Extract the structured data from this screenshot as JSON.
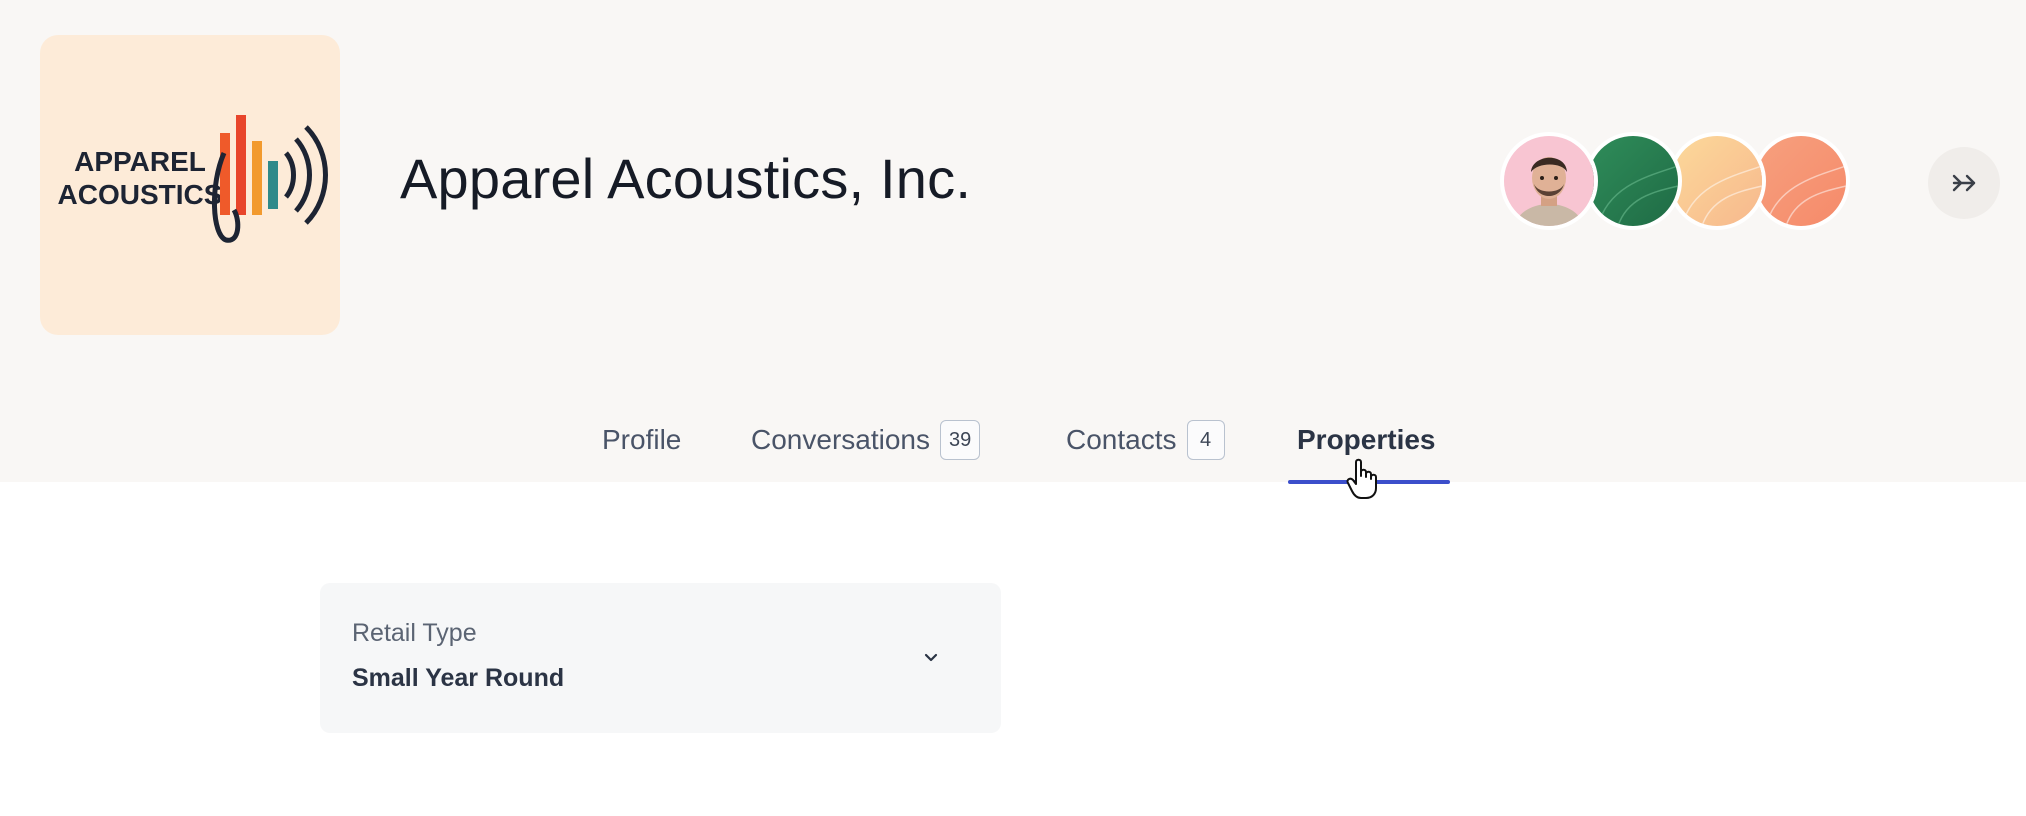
{
  "company": {
    "name": "Apparel Acoustics, Inc.",
    "logo_text_line1": "APPAREL",
    "logo_text_line2": "ACOUSTICS"
  },
  "header": {
    "avatars": [
      "person-avatar",
      "green-avatar",
      "yellow-avatar",
      "orange-avatar"
    ],
    "expand_icon": "double-chevron-right-icon"
  },
  "tabs": [
    {
      "label": "Profile",
      "count": null,
      "active": false
    },
    {
      "label": "Conversations",
      "count": "39",
      "active": false
    },
    {
      "label": "Contacts",
      "count": "4",
      "active": false
    },
    {
      "label": "Properties",
      "count": null,
      "active": true
    }
  ],
  "properties": [
    {
      "label": "Retail Type",
      "value": "Small Year Round",
      "icon": "chevron-down-icon"
    }
  ],
  "colors": {
    "header_bg": "#f9f7f5",
    "logo_bg": "#fdebd8",
    "accent": "#3c4fcb",
    "card_bg": "#f6f7f8"
  }
}
